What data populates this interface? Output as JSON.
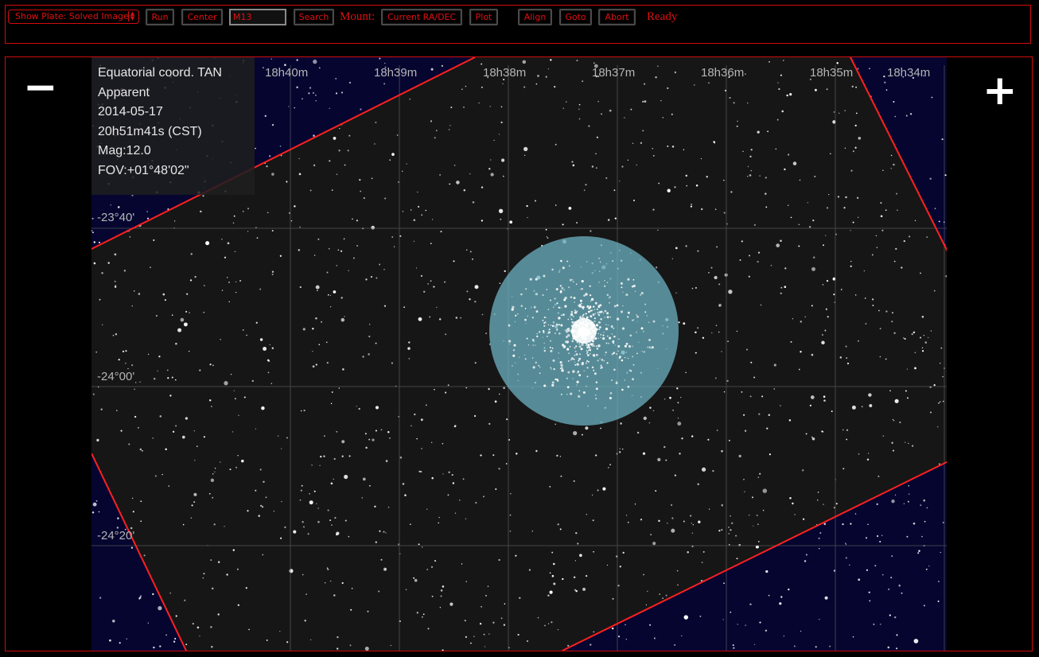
{
  "toolbar": {
    "image_select": "Show Plate: Solved Image",
    "run": "Run",
    "center": "Center",
    "search_value": "M13",
    "search": "Search",
    "mount_label": "Mount:",
    "current_radec": "Current RA/DEC",
    "plot": "Plot",
    "align": "Align",
    "goto": "Goto",
    "abort": "Abort",
    "status": "Ready"
  },
  "zoom": {
    "out": "−",
    "in": "+"
  },
  "info": {
    "lines": [
      "Equatorial coord. TAN",
      "Apparent",
      "2014-05-17",
      "20h51m41s (CST)",
      "Mag:12.0",
      "FOV:+01°48'02\""
    ]
  },
  "grid": {
    "ra_labels": [
      "18h40m",
      "18h39m",
      "18h38m",
      "18h37m",
      "18h36m",
      "18h35m",
      "18h34m"
    ],
    "dec_labels": [
      "-23°40'",
      "-24°00'",
      "-24°20'"
    ]
  },
  "colors": {
    "accent": "#e01010",
    "sky_background": "#050530",
    "target_circle": "#6fb7c8",
    "plate_border": "#ff2020"
  }
}
